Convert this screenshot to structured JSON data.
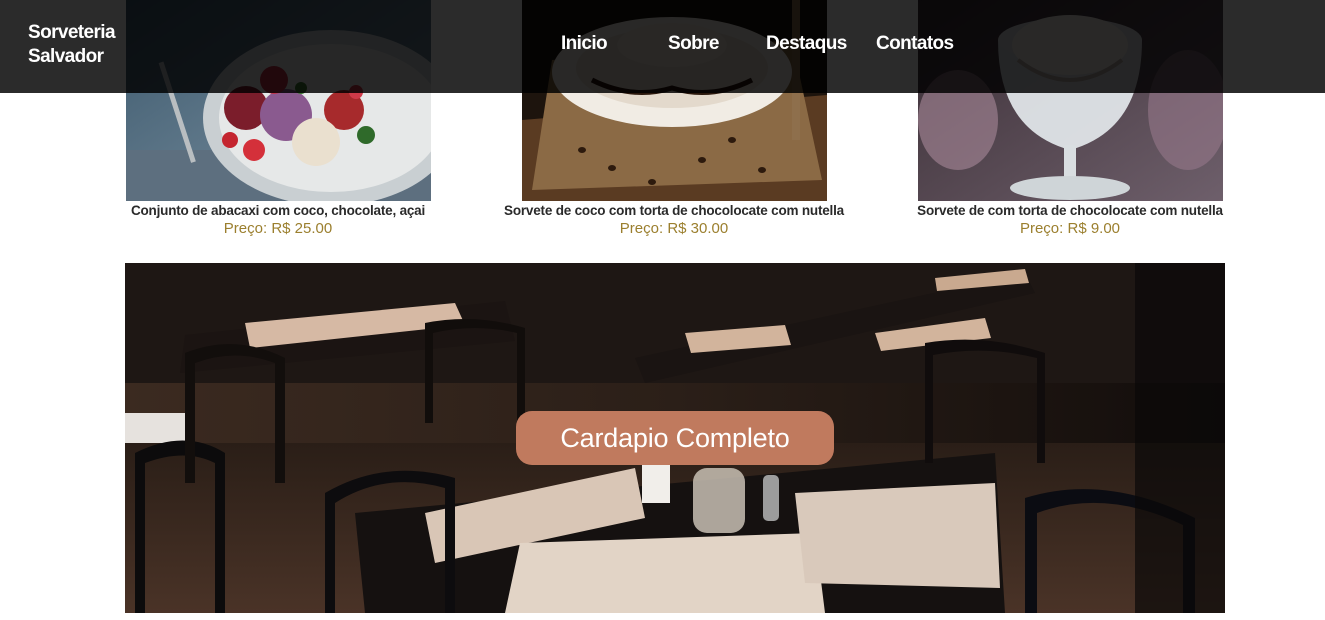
{
  "header": {
    "brand_line1": "Sorveteria",
    "brand_line2": "Salvador",
    "nav": [
      "Inicio",
      "Sobre",
      "Destaqus",
      "Contatos"
    ]
  },
  "products": [
    {
      "name": "Conjunto de abacaxi com coco, chocolate, açai",
      "price": "Preço: R$ 25.00"
    },
    {
      "name": "Sorvete de coco com torta de chocolocate com nutella",
      "price": "Preço: R$ 30.00"
    },
    {
      "name": "Sorvete de com torta de chocolocate com nutella",
      "price": "Preço: R$ 9.00"
    }
  ],
  "banner": {
    "button_label": "Cardapio Completo"
  },
  "colors": {
    "topbar": "#141414",
    "price": "#9b7f2e",
    "cta": "#c07a5e"
  },
  "icons": [
    "ice-cream-bowl-photo",
    "chocolate-cake-photo",
    "ice-cream-glass-photo",
    "restaurant-interior-photo"
  ]
}
